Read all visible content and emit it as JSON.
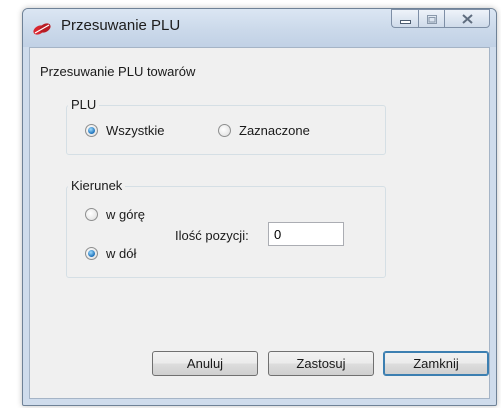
{
  "window": {
    "title": "Przesuwanie PLU",
    "icons": {
      "app": "app-logo-icon",
      "minimize": "minimize-icon",
      "maximize": "maximize-icon",
      "close": "close-icon"
    }
  },
  "main": {
    "header": "Przesuwanie PLU towarów",
    "plu_group": {
      "label": "PLU",
      "options": [
        {
          "label": "Wszystkie",
          "checked": true
        },
        {
          "label": "Zaznaczone",
          "checked": false
        }
      ]
    },
    "direction_group": {
      "label": "Kierunek",
      "options": [
        {
          "label": "w górę",
          "checked": false
        },
        {
          "label": "w dół",
          "checked": true
        }
      ],
      "quantity_label": "Ilość pozycji:",
      "quantity_value": "0"
    }
  },
  "buttons": {
    "cancel": "Anuluj",
    "apply": "Zastosuj",
    "close": "Zamknij"
  },
  "colors": {
    "accent": "#1b6fb8",
    "window_frame": "#cfdcec"
  }
}
